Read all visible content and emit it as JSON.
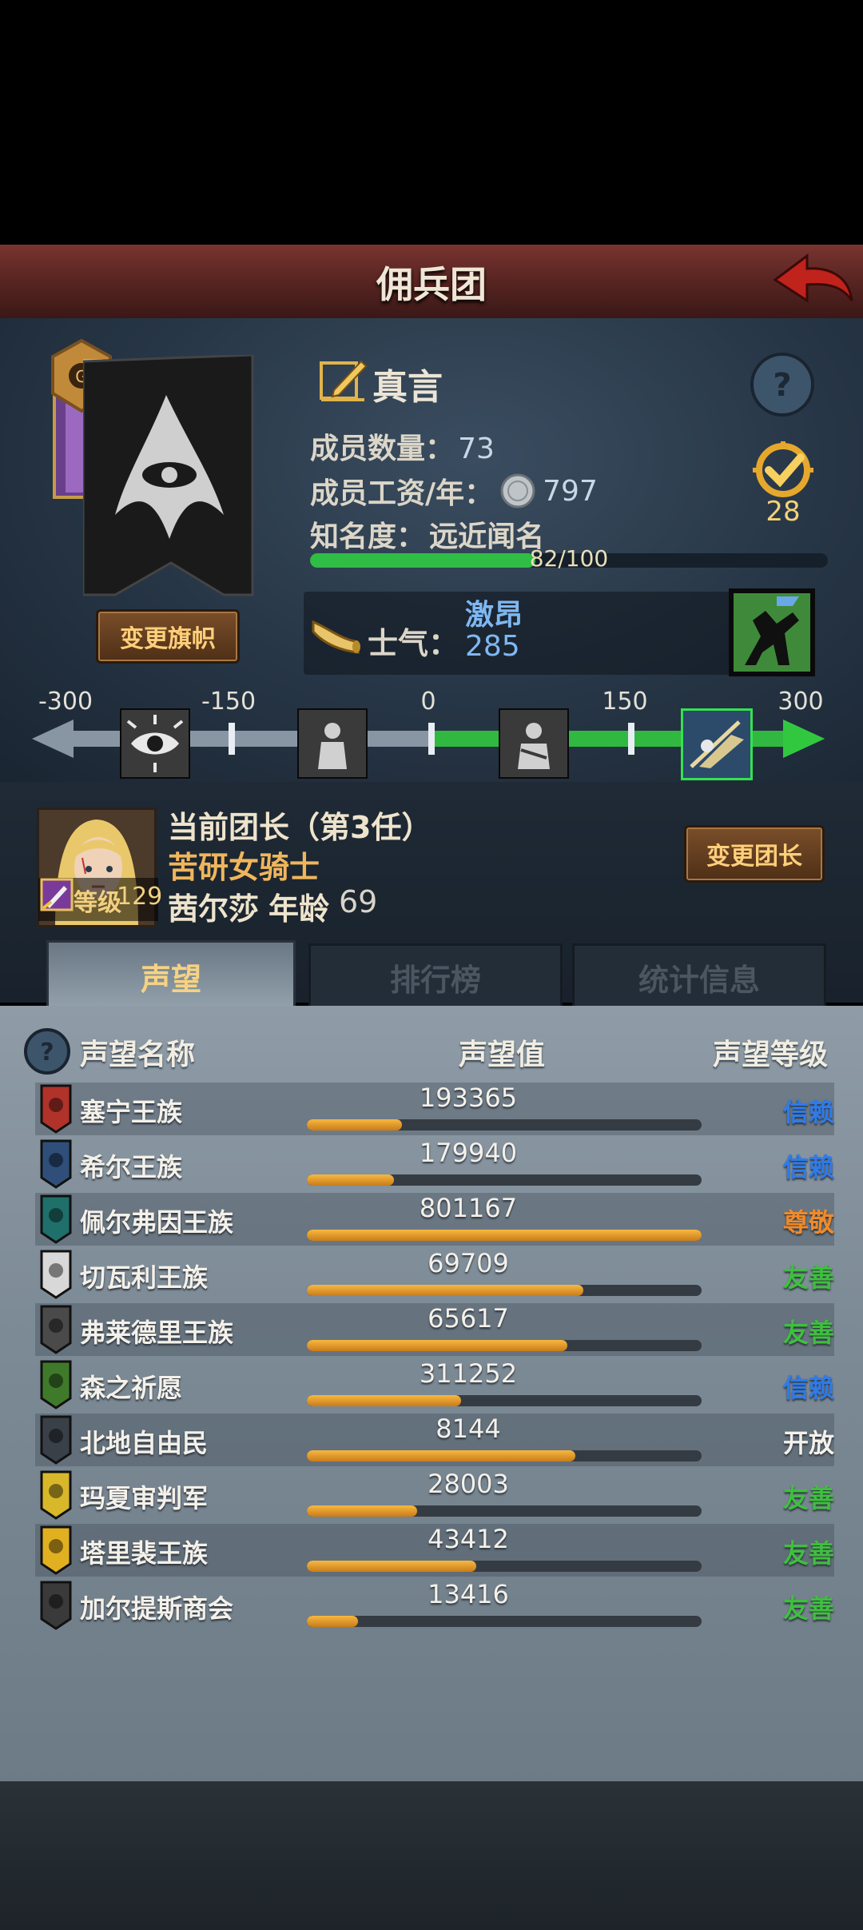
{
  "header": {
    "title": "佣兵团"
  },
  "guild": {
    "name": "真言",
    "members_label": "成员数量：",
    "members_value": "73",
    "wage_label": "成员工资/年：",
    "wage_value": "797",
    "fame_label": "知名度：",
    "fame_rank": "远近闻名",
    "fame_progress_text": "82/100",
    "fame_progress": 0.82,
    "badge_count": "28",
    "change_banner_label": "变更旗帜",
    "morale_label": "士气：",
    "morale_status": "激昂",
    "morale_value": "285"
  },
  "morale_scale": {
    "ticks": [
      "-300",
      "-150",
      "0",
      "150",
      "300"
    ],
    "value": 285,
    "min": -300,
    "max": 300
  },
  "leader": {
    "title": "当前团长（第3任）",
    "class": "苦研女骑士",
    "name": "茜尔莎",
    "age_label": "年龄",
    "age": "69",
    "level_label": "等级",
    "level": "129",
    "change_leader_label": "变更团长"
  },
  "tabs": {
    "reputation": "声望",
    "ranking": "排行榜",
    "stats": "统计信息"
  },
  "reputation": {
    "headers": {
      "name": "声望名称",
      "value": "声望值",
      "level": "声望等级"
    },
    "rows": [
      {
        "name": "塞宁王族",
        "value": "193365",
        "level": "信赖",
        "progress": 0.24,
        "level_color": "#2f7be8",
        "icon_color": "#b0322a"
      },
      {
        "name": "希尔王族",
        "value": "179940",
        "level": "信赖",
        "progress": 0.22,
        "level_color": "#2f7be8",
        "icon_color": "#2f4f7a"
      },
      {
        "name": "佩尔弗因王族",
        "value": "801167",
        "level": "尊敬",
        "progress": 1.0,
        "level_color": "#f08a2a",
        "icon_color": "#1f6f6a"
      },
      {
        "name": "切瓦利王族",
        "value": "69709",
        "level": "友善",
        "progress": 0.7,
        "level_color": "#3fbf3f",
        "icon_color": "#d8d8d8"
      },
      {
        "name": "弗莱德里王族",
        "value": "65617",
        "level": "友善",
        "progress": 0.66,
        "level_color": "#3fbf3f",
        "icon_color": "#4a4a4a"
      },
      {
        "name": "森之祈愿",
        "value": "311252",
        "level": "信赖",
        "progress": 0.39,
        "level_color": "#2f7be8",
        "icon_color": "#3f7a2a"
      },
      {
        "name": "北地自由民",
        "value": "8144",
        "level": "开放",
        "progress": 0.68,
        "level_color": "#f4f1ea",
        "icon_color": "#3a4048"
      },
      {
        "name": "玛夏审判军",
        "value": "28003",
        "level": "友善",
        "progress": 0.28,
        "level_color": "#3fbf3f",
        "icon_color": "#d8b82a"
      },
      {
        "name": "塔里裴王族",
        "value": "43412",
        "level": "友善",
        "progress": 0.43,
        "level_color": "#3fbf3f",
        "icon_color": "#e0b020"
      },
      {
        "name": "加尔提斯商会",
        "value": "13416",
        "level": "友善",
        "progress": 0.13,
        "level_color": "#3fbf3f",
        "icon_color": "#3a3a3a"
      }
    ]
  }
}
